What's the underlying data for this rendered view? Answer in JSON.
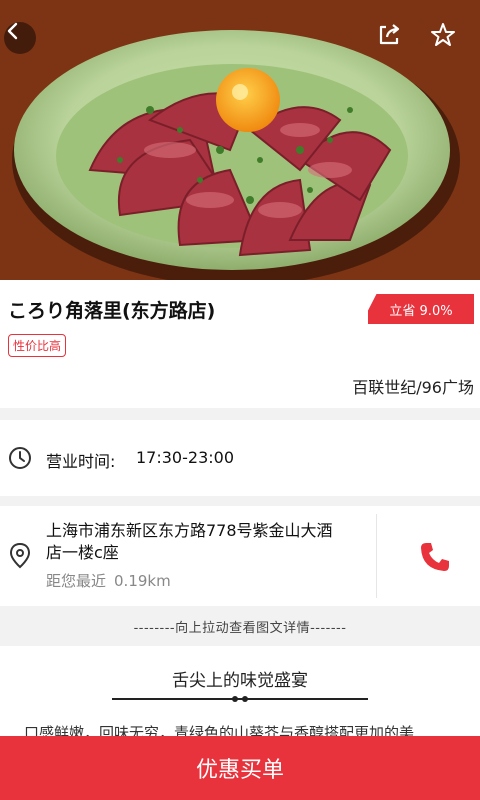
{
  "header": {
    "back_icon": "chevron-left-icon",
    "share_icon": "share-icon",
    "favorite_icon": "star-outline-icon"
  },
  "shop": {
    "name": "ころり角落里(东方路店)",
    "save_badge": "立省 9.0%",
    "tag": "性价比高",
    "area": "百联世纪/96广场"
  },
  "hours": {
    "icon": "clock-icon",
    "label": "营业时间:",
    "value": "17:30-23:00"
  },
  "address": {
    "icon": "location-pin-icon",
    "text": "上海市浦东新区东方路778号紫金山大酒店一楼c座",
    "distance_label": "距您最近",
    "distance_value": "0.19km",
    "phone_icon": "phone-icon"
  },
  "pull_hint": "--------向上拉动查看图文详情-------",
  "detail": {
    "title": "舌尖上的味觉盛宴",
    "body": "口感鲜嫩，回味无穷，青绿色的山葵芥与香醇搭配更加的美"
  },
  "bottom": {
    "buy_label": "优惠买单"
  },
  "colors": {
    "accent": "#e8323c",
    "separator": "#f2f2f2"
  }
}
